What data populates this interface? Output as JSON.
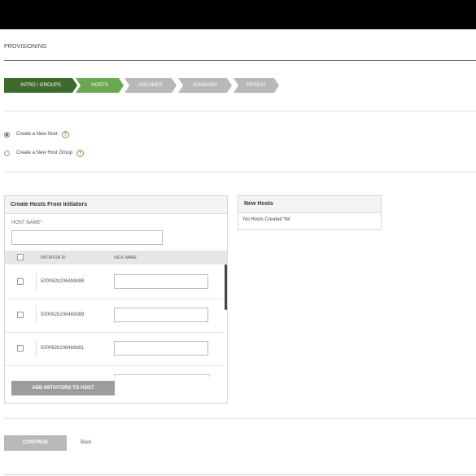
{
  "page": {
    "title": "PROVISIONING"
  },
  "steps": [
    {
      "label": "INTRO / GROUPS",
      "state": "done"
    },
    {
      "label": "HOSTS",
      "state": "active"
    },
    {
      "label": "VOLUMES",
      "state": "todo"
    },
    {
      "label": "SUMMARY",
      "state": "todo"
    },
    {
      "label": "REPEAT",
      "state": "todo"
    }
  ],
  "options": {
    "new_host": {
      "label": "Create a New Host",
      "selected": true
    },
    "new_host_group": {
      "label": "Create a New Host Group",
      "selected": false
    },
    "help_glyph": "?"
  },
  "create_panel": {
    "title": "Create Hosts From Initiators",
    "host_name_label": "HOST NAME",
    "required_mark": "*",
    "host_name_value": "",
    "columns": {
      "initiator": "INITIATOR ID",
      "nickname": "NICK NAME"
    },
    "rows": [
      {
        "initiator_id": "500062b2064b9d88",
        "nickname": ""
      },
      {
        "initiator_id": "500062b2064b9d89",
        "nickname": ""
      },
      {
        "initiator_id": "500062b2064b9d81",
        "nickname": ""
      }
    ],
    "add_button": "ADD INITIATORS TO HOST"
  },
  "new_hosts_panel": {
    "title": "New Hosts",
    "empty_text": "No Hosts Created Yet"
  },
  "footer": {
    "continue_label": "CONTINUE",
    "back_label": "Back"
  },
  "colors": {
    "step_done": "#3d6b2c",
    "step_active": "#6aa84f",
    "step_todo": "#b8b8b8",
    "link": "#3d6b2c"
  }
}
